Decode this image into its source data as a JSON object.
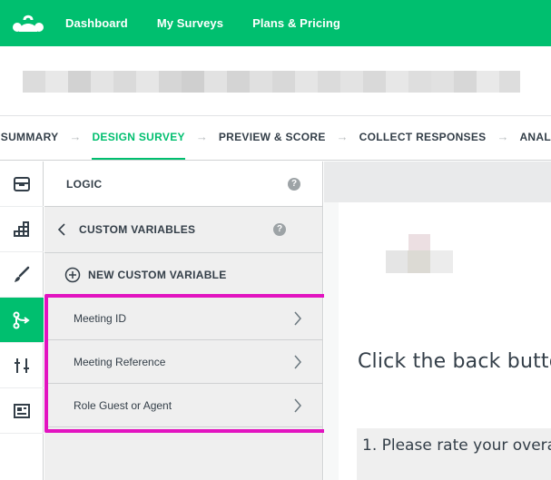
{
  "colors": {
    "brand_green": "#00bf6f",
    "highlight_magenta": "#e213c0"
  },
  "topnav": {
    "logo_icon": "surveymonkey-logo",
    "items": [
      {
        "label": "Dashboard"
      },
      {
        "label": "My Surveys"
      },
      {
        "label": "Plans & Pricing"
      }
    ]
  },
  "title_bar": {
    "survey_title": ""
  },
  "steps": [
    {
      "label": "SUMMARY"
    },
    {
      "label": "DESIGN SURVEY",
      "active": true
    },
    {
      "label": "PREVIEW & SCORE"
    },
    {
      "label": "COLLECT RESPONSES"
    },
    {
      "label": "ANAL"
    }
  ],
  "rail": {
    "items": [
      {
        "icon": "question-bank-icon"
      },
      {
        "icon": "builder-icon"
      },
      {
        "icon": "paint-brush-icon"
      },
      {
        "icon": "logic-icon",
        "active": true
      },
      {
        "icon": "options-sliders-icon"
      },
      {
        "icon": "layout-icon"
      }
    ]
  },
  "panel": {
    "header": "LOGIC",
    "help_glyph": "?",
    "sub_header": "CUSTOM VARIABLES",
    "new_variable": "NEW CUSTOM VARIABLE",
    "variables": [
      {
        "label": "Meeting ID"
      },
      {
        "label": "Meeting Reference"
      },
      {
        "label": "Role Guest or Agent"
      }
    ]
  },
  "preview": {
    "back_text": "Click the back butto",
    "question": "1. Please rate your overa"
  }
}
